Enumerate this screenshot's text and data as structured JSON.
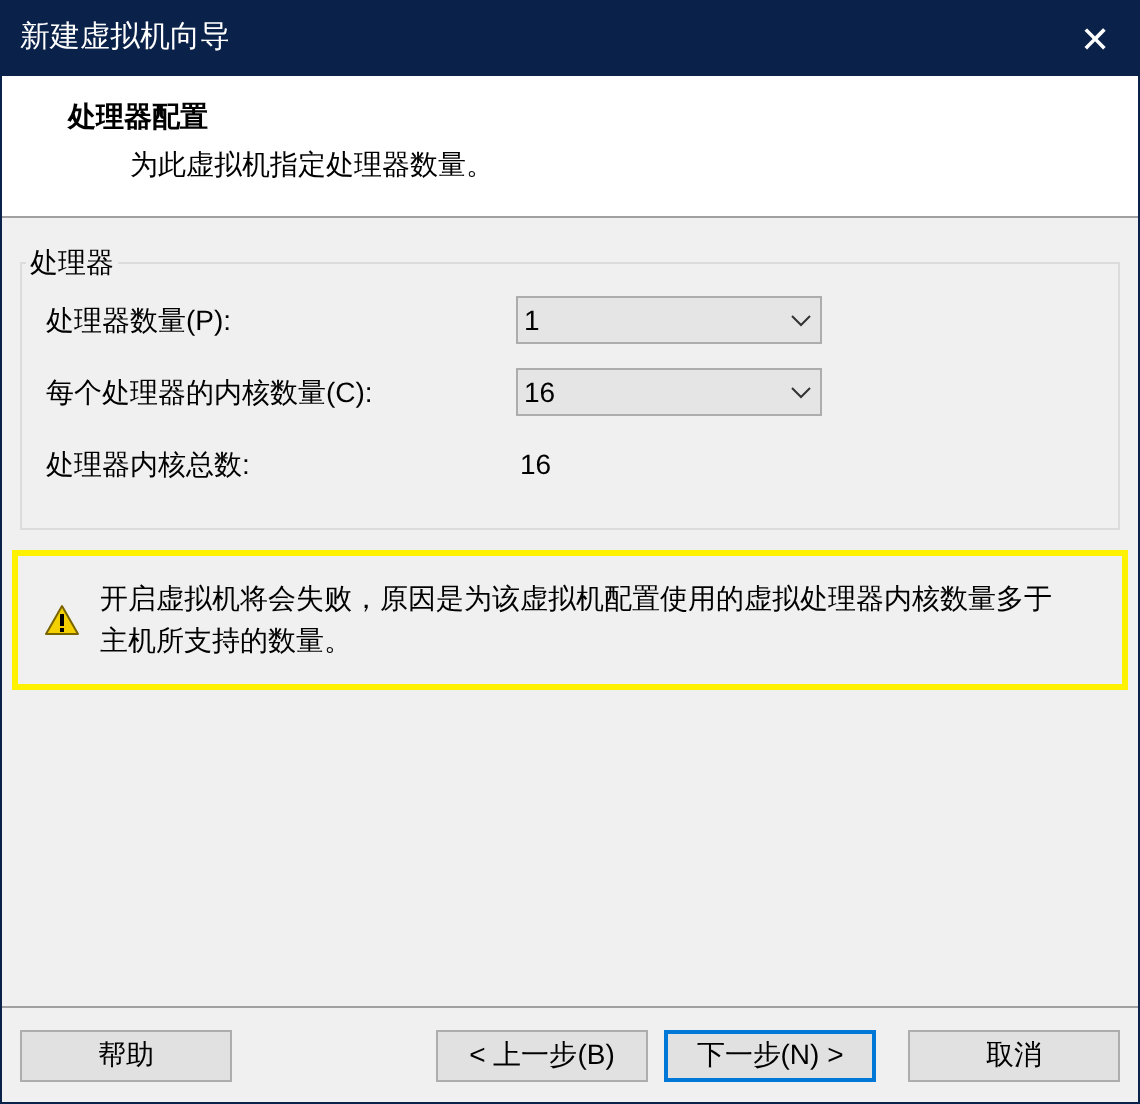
{
  "window": {
    "title": "新建虚拟机向导",
    "close": "✕"
  },
  "header": {
    "title": "处理器配置",
    "subtitle": "为此虚拟机指定处理器数量。"
  },
  "group": {
    "title": "处理器",
    "rows": [
      {
        "kind": "combo",
        "label": "处理器数量(P):",
        "value": "1"
      },
      {
        "kind": "combo",
        "label": "每个处理器的内核数量(C):",
        "value": "16"
      },
      {
        "kind": "value",
        "label": "处理器内核总数:",
        "value": "16"
      }
    ]
  },
  "warning": {
    "text": "开启虚拟机将会失败，原因是为该虚拟机配置使用的虚拟处理器内核数量多于主机所支持的数量。"
  },
  "footer": {
    "left_buttons": [
      {
        "label": "帮助",
        "focused": false
      }
    ],
    "right_buttons": [
      {
        "label": "< 上一步(B)",
        "focused": false
      },
      {
        "label": "下一步(N) >",
        "focused": true
      },
      {
        "label": "取消",
        "focused": false
      }
    ]
  }
}
